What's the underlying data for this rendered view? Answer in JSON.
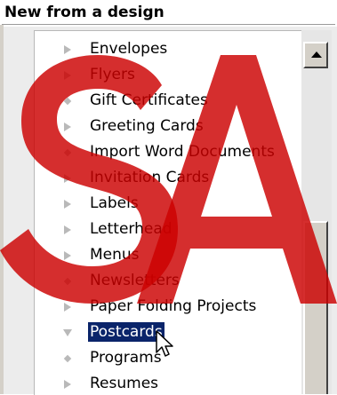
{
  "header": {
    "title": "New from a design"
  },
  "list": {
    "items": [
      {
        "label": "Envelopes",
        "bullet": "expand-arrow-right"
      },
      {
        "label": "Flyers",
        "bullet": "expand-arrow-right"
      },
      {
        "label": "Gift Certificates",
        "bullet": "diamond"
      },
      {
        "label": "Greeting Cards",
        "bullet": "expand-arrow-right"
      },
      {
        "label": "Import Word Documents",
        "bullet": "diamond"
      },
      {
        "label": "Invitation Cards",
        "bullet": "expand-arrow-right"
      },
      {
        "label": "Labels",
        "bullet": "expand-arrow-right"
      },
      {
        "label": "Letterhead",
        "bullet": "expand-arrow-right"
      },
      {
        "label": "Menus",
        "bullet": "expand-arrow-right"
      },
      {
        "label": "Newsletters",
        "bullet": "diamond"
      },
      {
        "label": "Paper Folding Projects",
        "bullet": "expand-arrow-right"
      },
      {
        "label": "Postcards",
        "bullet": "expand-arrow-down",
        "selected": true
      },
      {
        "label": "Programs",
        "bullet": "diamond"
      },
      {
        "label": "Resumes",
        "bullet": "expand-arrow-right"
      }
    ]
  },
  "colors": {
    "selection": "#0a246a",
    "watermark": "#cc0000"
  }
}
